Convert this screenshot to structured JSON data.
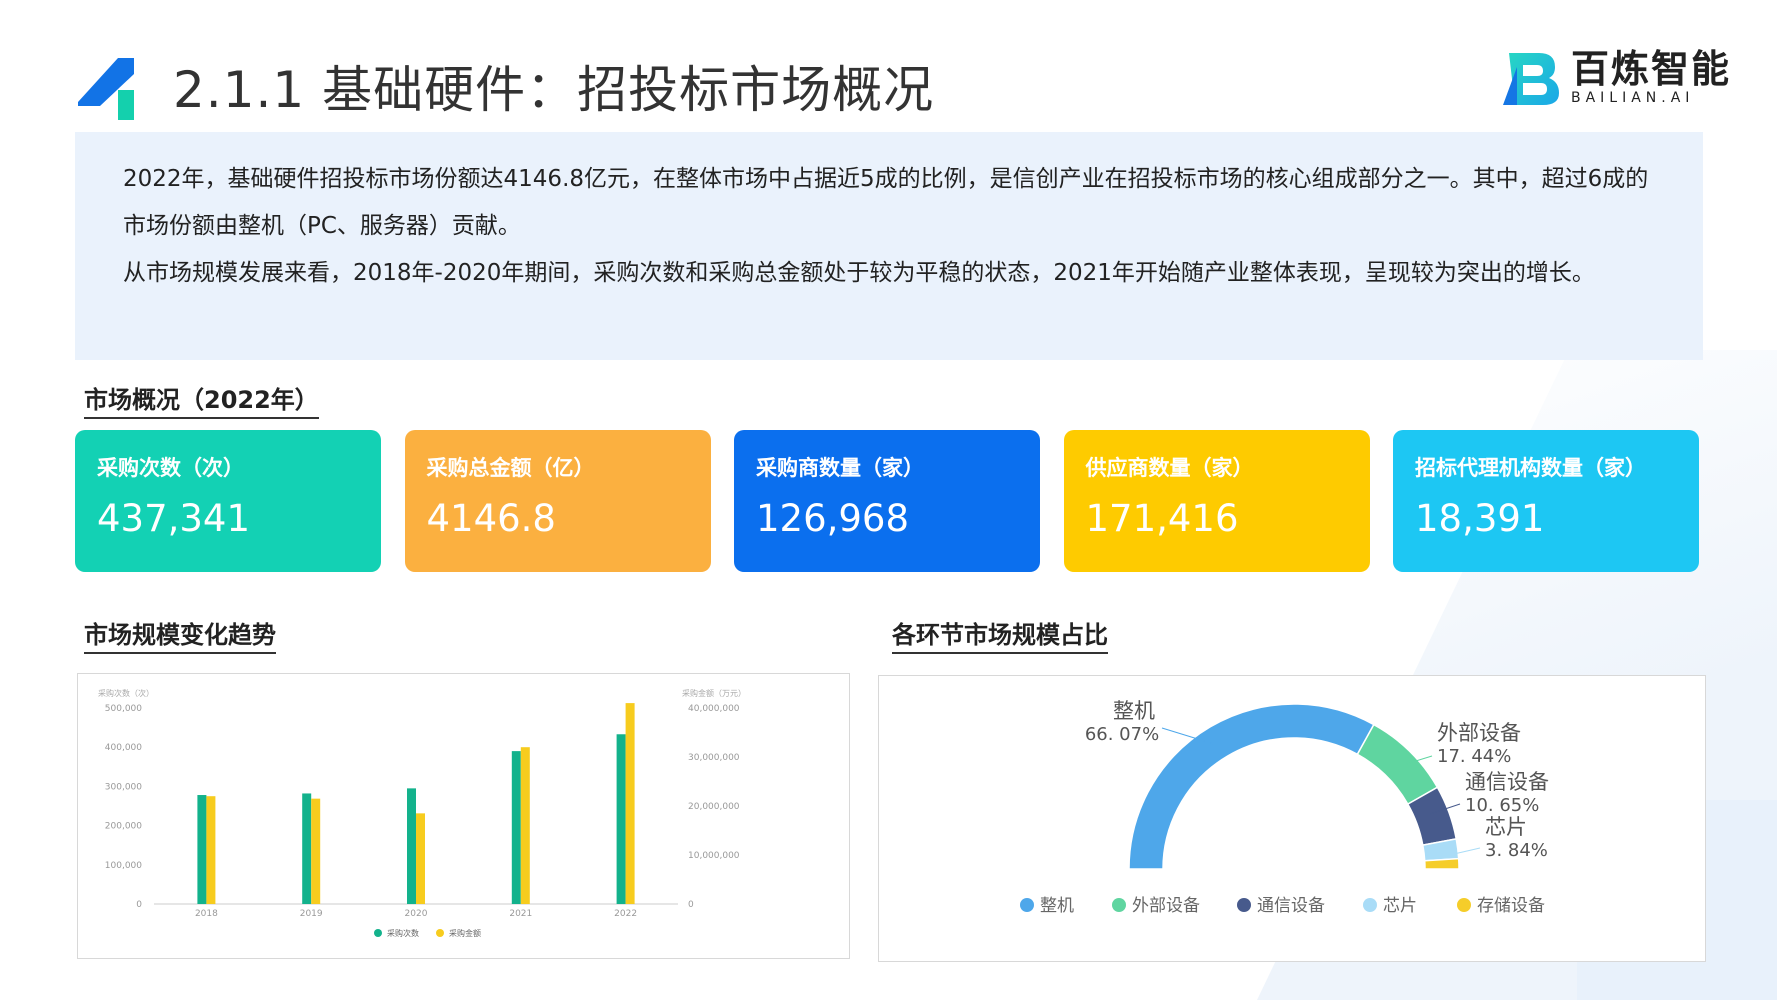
{
  "header": {
    "title": "2.1.1 基础硬件：招投标市场概况",
    "brand_cn": "百炼智能",
    "brand_en": "BAILIAN.AI"
  },
  "intro": {
    "paragraphs": [
      "2022年，基础硬件招投标市场份额达4146.8亿元，在整体市场中占据近5成的比例，是信创产业在招投标市场的核心组成部分之一。其中，超过6成的市场份额由整机（PC、服务器）贡献。",
      "从市场规模发展来看，2018年-2020年期间，采购次数和采购总金额处于较为平稳的状态，2021年开始随产业整体表现，呈现较为突出的增长。"
    ]
  },
  "overview": {
    "title": "市场概况（2022年）",
    "cards": [
      {
        "label": "采购次数（次）",
        "value": "437,341",
        "color": "#13d1b4"
      },
      {
        "label": "采购总金额（亿）",
        "value": "4146.8",
        "color": "#fbb040"
      },
      {
        "label": "采购商数量（家）",
        "value": "126,968",
        "color": "#0b6fee"
      },
      {
        "label": "供应商数量（家）",
        "value": "171,416",
        "color": "#fecb00"
      },
      {
        "label": "招标代理机构数量（家）",
        "value": "18,391",
        "color": "#1dc7f3"
      }
    ]
  },
  "trend": {
    "title": "市场规模变化趋势"
  },
  "share": {
    "title": "各环节市场规模占比"
  },
  "chart_data": [
    {
      "type": "bar",
      "categories": [
        "2018",
        "2019",
        "2020",
        "2021",
        "2022"
      ],
      "series": [
        {
          "name": "采购次数",
          "values": [
            278000,
            282000,
            295000,
            390000,
            433000
          ],
          "color": "#13b28c",
          "axis": "left"
        },
        {
          "name": "采购金额",
          "values": [
            22000000,
            21500000,
            18500000,
            32000000,
            41000000
          ],
          "color": "#f7cc1e",
          "axis": "right"
        }
      ],
      "ylabel": "采购次数（次）",
      "ylabel_right": "采购金额（万元）",
      "ylim": [
        0,
        500000
      ],
      "ylim_right": [
        0,
        40000000
      ],
      "yticks": [
        "0",
        "100,000",
        "200,000",
        "300,000",
        "400,000",
        "500,000"
      ],
      "yticks_right": [
        "0",
        "10,000,000",
        "20,000,000",
        "30,000,000",
        "40,000,000"
      ],
      "legend": "bottom"
    },
    {
      "type": "pie",
      "variant": "half-donut",
      "categories": [
        "整机",
        "外部设备",
        "通信设备",
        "芯片",
        "存储设备"
      ],
      "values": [
        66.07,
        17.44,
        10.65,
        3.84,
        2.0
      ],
      "colors": [
        "#4ea7ea",
        "#5fd5a0",
        "#475a8c",
        "#a9dcf7",
        "#f5cd2a"
      ],
      "labels": [
        {
          "name": "整机",
          "pct": "66. 07%"
        },
        {
          "name": "外部设备",
          "pct": "17. 44%"
        },
        {
          "name": "通信设备",
          "pct": "10. 65%"
        },
        {
          "name": "芯片",
          "pct": "3. 84%"
        }
      ],
      "legend": "bottom"
    }
  ]
}
